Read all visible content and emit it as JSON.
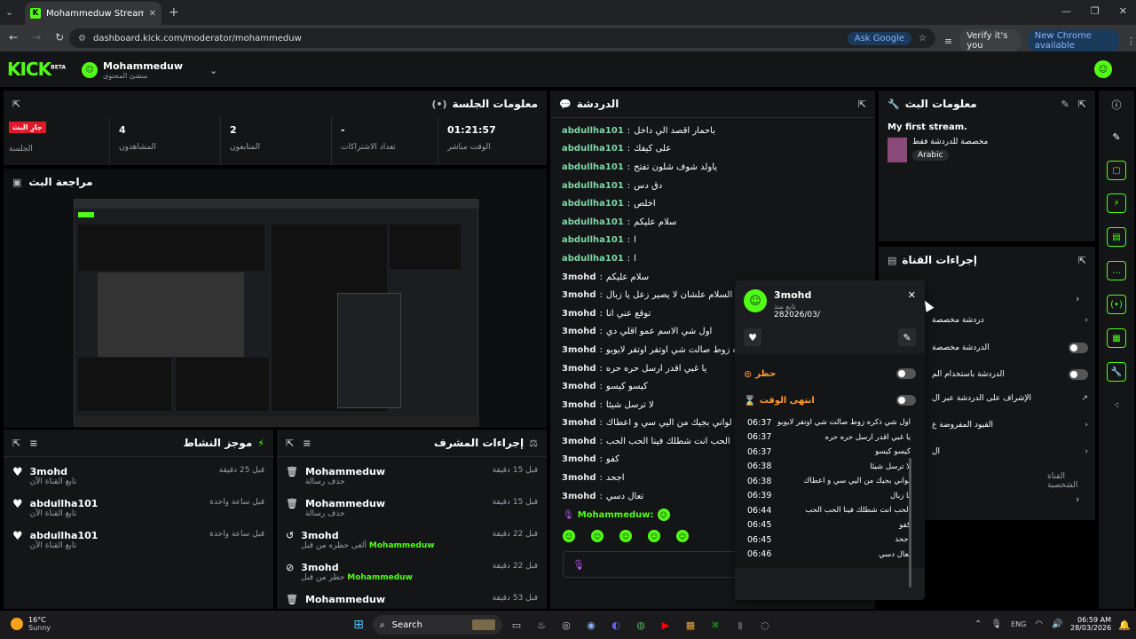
{
  "browser": {
    "tab_title": "Mohammeduw Stream - Kick D",
    "url": "dashboard.kick.com/moderator/mohammeduw",
    "ask_google": "Ask Google",
    "verify": "Verify it's you",
    "new_chrome": "New Chrome available"
  },
  "header": {
    "logo": "KICK",
    "beta": "BETA",
    "channel_name": "Mohammeduw",
    "channel_role": "منشئ المحتوى"
  },
  "session": {
    "title": "معلومات الجلسة",
    "live_badge": "جارِ البث",
    "live_label": "الجلسة",
    "stats": [
      {
        "value": "01:21:57",
        "label": "الوقت مباشر"
      },
      {
        "value": "-",
        "label": "تعداد الاشتراكات"
      },
      {
        "value": "2",
        "label": "المتابعون"
      },
      {
        "value": "4",
        "label": "المشاهدون"
      }
    ]
  },
  "preview": {
    "title": "مراجعة البث"
  },
  "chat": {
    "title": "الدردشة",
    "messages": [
      {
        "user": "abdullha101",
        "text": "باحمار اقصد الي داخل"
      },
      {
        "user": "abdullha101",
        "text": "على كيفك"
      },
      {
        "user": "abdullha101",
        "text": "ياولد شوف شلون تفتح"
      },
      {
        "user": "abdullha101",
        "text": "دق دس"
      },
      {
        "user": "abdullha101",
        "text": "اخلص"
      },
      {
        "user": "abdullha101",
        "text": "سلام عليكم"
      },
      {
        "user": "abdullha101",
        "text": "ا"
      },
      {
        "user": "abdullha101",
        "text": "ا"
      },
      {
        "user": "3mohd",
        "text": "سلام عليكم"
      },
      {
        "user": "3mohd",
        "text": "رد السلام علشان لا يصير زعل يا زبال"
      },
      {
        "user": "3mohd",
        "text": "توقع عني انا"
      },
      {
        "user": "3mohd",
        "text": "اول شي الاسم عمو اقلي دي"
      },
      {
        "user": "3mohd",
        "text": "اول شي ذكره زوط صالت شي اوتفر اوتفر لايوبو"
      },
      {
        "user": "3mohd",
        "text": "يا غبي اقدر ارسل حره حره"
      },
      {
        "user": "3mohd",
        "text": "كيسو كيسو"
      },
      {
        "user": "3mohd",
        "text": "لا ترسل شيئا"
      },
      {
        "user": "3mohd",
        "text": "لواني بجيك من اليي سي و اعطاك"
      },
      {
        "user": "3mohd",
        "text": "الحب انت شطلك فينا الحب الحب"
      },
      {
        "user": "3mohd",
        "text": "كفو"
      },
      {
        "user": "3mohd",
        "text": "اجحد"
      },
      {
        "user": "3mohd",
        "text": "تعال دسي"
      }
    ],
    "mod_user": "Mohammeduw:"
  },
  "stream_info": {
    "title": "معلومات البث",
    "stream_title": "My first stream.",
    "tag_line": "مخصصة للدردشة فقط",
    "language": "Arabic"
  },
  "channel_actions": {
    "title": "إجراءات القناة",
    "items": [
      {
        "label": "دردشة مخصصة"
      },
      {
        "label": "الدردشة مخصصة"
      },
      {
        "label": "الدردشة باستخدام الم"
      },
      {
        "label": "الإشراف على الدردشة عبر ال"
      },
      {
        "label": "القيود المفروضة ع"
      },
      {
        "label": "ال"
      }
    ],
    "section_label": "القناة الشخصية"
  },
  "activity": {
    "title": "موجز النشاط",
    "items": [
      {
        "user": "3mohd",
        "action": "تابع القناة الآن",
        "time": "قبل 25 دقيقة"
      },
      {
        "user": "abdullha101",
        "action": "تابع القناة الآن",
        "time": "قبل ساعة واحدة"
      },
      {
        "user": "abdullha101",
        "action": "تابع القناة الآن",
        "time": "قبل ساعة واحدة"
      }
    ]
  },
  "mod_actions": {
    "title": "إجراءات المشرف",
    "items": [
      {
        "user": "Mohammeduw",
        "action": "حذف رسالة",
        "extra": "",
        "time": "قبل 15 دقيقة",
        "icon": "trash-icon"
      },
      {
        "user": "Mohammeduw",
        "action": "حذف رسالة",
        "extra": "",
        "time": "قبل 15 دقيقة",
        "icon": "trash-icon"
      },
      {
        "user": "3mohd",
        "action": "ألغى حظره من قبل",
        "extra": "Mohammeduw",
        "time": "قبل 22 دقيقة",
        "icon": "undo-icon"
      },
      {
        "user": "3mohd",
        "action": "حظر من قبل",
        "extra": "Mohammeduw",
        "time": "قبل 22 دقيقة",
        "icon": "ban-icon"
      },
      {
        "user": "Mohammeduw",
        "action": "",
        "extra": "",
        "time": "قبل 53 دقيقة",
        "icon": "trash-icon"
      }
    ]
  },
  "user_card": {
    "name": "3mohd",
    "follow_label": "تابع منذ",
    "follow_date": "282026/03/",
    "ban_label": "حظر",
    "timeout_label": "انتهى الوقت",
    "log": [
      {
        "text": "اول شي ذكره زوط صالت شي اوتفر لايوبو",
        "time": "06:37"
      },
      {
        "text": "يا غبي اقدر ارسل حره حره",
        "time": "06:37"
      },
      {
        "text": "كيسو كيسو",
        "time": "06:37"
      },
      {
        "text": "لا ترسل شيئا",
        "time": "06:38"
      },
      {
        "text": "لواني بجيك من اليي سي و اعطاك",
        "time": "06:38"
      },
      {
        "text": "يا زبال",
        "time": "06:39"
      },
      {
        "text": "الحب انت شطلك فينا الحب الحب",
        "time": "06:44"
      },
      {
        "text": "كفو",
        "time": "06:45"
      },
      {
        "text": "اجحد",
        "time": "06:45"
      },
      {
        "text": "تعال دسي",
        "time": "06:46"
      }
    ]
  },
  "taskbar": {
    "temp": "16°C",
    "weather": "Sunny",
    "search": "Search",
    "lang": "ENG",
    "time": "06:59 AM",
    "date": "28/03/2026"
  }
}
